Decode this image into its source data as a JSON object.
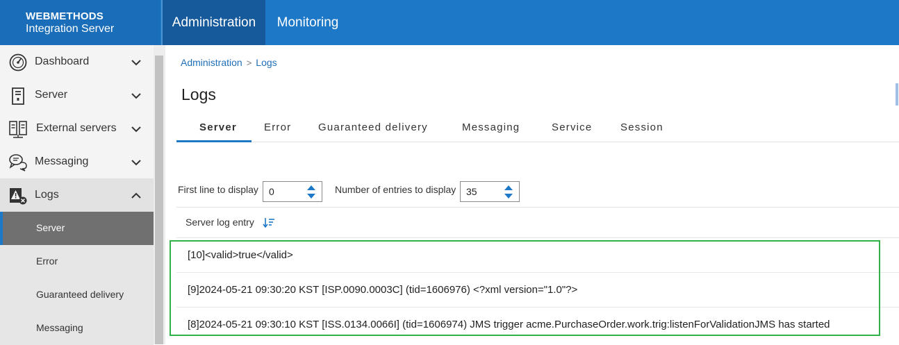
{
  "brand": {
    "line1": "WEBMETHODS",
    "line2": "Integration Server"
  },
  "top_tabs": [
    {
      "label": "Administration",
      "active": true
    },
    {
      "label": "Monitoring",
      "active": false
    }
  ],
  "sidebar": {
    "items": [
      {
        "label": "Dashboard",
        "icon": "dashboard-gauge-icon",
        "expanded": false
      },
      {
        "label": "Server",
        "icon": "server-icon",
        "expanded": false
      },
      {
        "label": "External servers",
        "icon": "external-servers-icon",
        "expanded": false
      },
      {
        "label": "Messaging",
        "icon": "messaging-chat-icon",
        "expanded": false
      },
      {
        "label": "Logs",
        "icon": "logs-warning-icon",
        "expanded": true
      }
    ],
    "sub_items": [
      {
        "label": "Server",
        "active": true
      },
      {
        "label": "Error",
        "active": false
      },
      {
        "label": "Guaranteed delivery",
        "active": false
      },
      {
        "label": "Messaging",
        "active": false
      }
    ]
  },
  "breadcrumb": {
    "root": "Administration",
    "separator": ">",
    "current": "Logs"
  },
  "page_title": "Logs",
  "log_tabs": [
    {
      "label": "Server",
      "active": true
    },
    {
      "label": "Error",
      "active": false
    },
    {
      "label": "Guaranteed delivery",
      "active": false
    },
    {
      "label": "Messaging",
      "active": false
    },
    {
      "label": "Service",
      "active": false
    },
    {
      "label": "Session",
      "active": false
    }
  ],
  "controls": {
    "first_line_label": "First line to display",
    "first_line_value": "0",
    "entries_label": "Number of entries to display",
    "entries_value": "35"
  },
  "table": {
    "column_header": "Server log entry",
    "rows": [
      "[10]<valid>true</valid>",
      "[9]2024-05-21 09:30:20 KST [ISP.0090.0003C] (tid=1606976) <?xml version=\"1.0\"?>",
      "[8]2024-05-21 09:30:10 KST [ISS.0134.0066I] (tid=1606974) JMS trigger acme.PurchaseOrder.work.trig:listenForValidationJMS has started"
    ]
  },
  "colors": {
    "topbar": "#1e78c8",
    "active_top_tab": "#165a9c",
    "accent": "#1e78c8",
    "highlight_box": "#2fb24a",
    "active_sidebar_item": "#707070"
  }
}
